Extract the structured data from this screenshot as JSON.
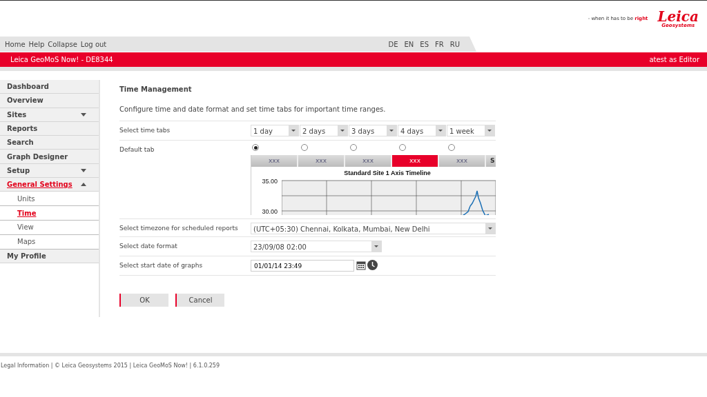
{
  "header": {
    "tagline": "- when it has to be **right**",
    "logo": {
      "name": "Leica",
      "sub": "Geosystems"
    }
  },
  "top_nav": {
    "links": [
      "Home",
      "Help",
      "Collapse",
      "Log out"
    ],
    "languages": [
      "DE",
      "EN",
      "ES",
      "FR",
      "RU"
    ]
  },
  "title_bar": {
    "title": "Leica GeoMoS Now!  - DE8344",
    "user": "atest as Editor"
  },
  "sidebar": {
    "items": [
      {
        "label": "Dashboard",
        "selected": false
      },
      {
        "label": "Overview",
        "selected": false
      },
      {
        "label": "Sites",
        "selected": false,
        "expanded": false
      },
      {
        "label": "Reports",
        "selected": false
      },
      {
        "label": "Search",
        "selected": false
      },
      {
        "label": "Graph Designer",
        "selected": false
      },
      {
        "label": "Setup",
        "selected": false,
        "expanded": false
      },
      {
        "label": "General Settings",
        "selected": true,
        "expanded": true,
        "children": [
          {
            "label": "Units",
            "selected": false
          },
          {
            "label": "Time",
            "selected": true
          },
          {
            "label": "View",
            "selected": false
          },
          {
            "label": "Maps",
            "selected": false
          }
        ]
      },
      {
        "label": "My Profile",
        "selected": false
      }
    ]
  },
  "content": {
    "title": "Time Management",
    "description": "Configure time and date format and set time tabs for important time ranges.",
    "time_tabs": {
      "label": "Select time tabs",
      "values": [
        "1 day",
        "2 days",
        "3 days",
        "4 days",
        "1 week"
      ]
    },
    "default_tab": {
      "label": "Default tab",
      "options": [
        {
          "selected": true
        },
        {
          "selected": false
        },
        {
          "selected": false
        },
        {
          "selected": false
        },
        {
          "selected": false
        }
      ]
    },
    "preview": {
      "tabs": [
        {
          "label": "xxx",
          "selected": false
        },
        {
          "label": "xxx",
          "selected": false
        },
        {
          "label": "xxx",
          "selected": false
        },
        {
          "label": "xxx",
          "selected": true
        },
        {
          "label": "xxx",
          "selected": false
        },
        {
          "label": "S",
          "selected": false
        }
      ],
      "title": "Standard Site 1 Axis Timeline",
      "y_labels": [
        "35.00",
        "30.00"
      ]
    },
    "timezone": {
      "label": "Select timezone for scheduled reports",
      "value": "(UTC+05:30) Chennai, Kolkata, Mumbai, New Delhi"
    },
    "date_format": {
      "label": "Select date format",
      "value": "23/09/08 02:00"
    },
    "start_date": {
      "label": "Select start date of graphs",
      "value": "01/01/14 23:49"
    },
    "buttons": [
      "OK",
      "Cancel"
    ]
  },
  "footer": "Legal Information | © Leica Geosystems 2015 | Leica GeoMoS Now! | 6.1.0.259"
}
